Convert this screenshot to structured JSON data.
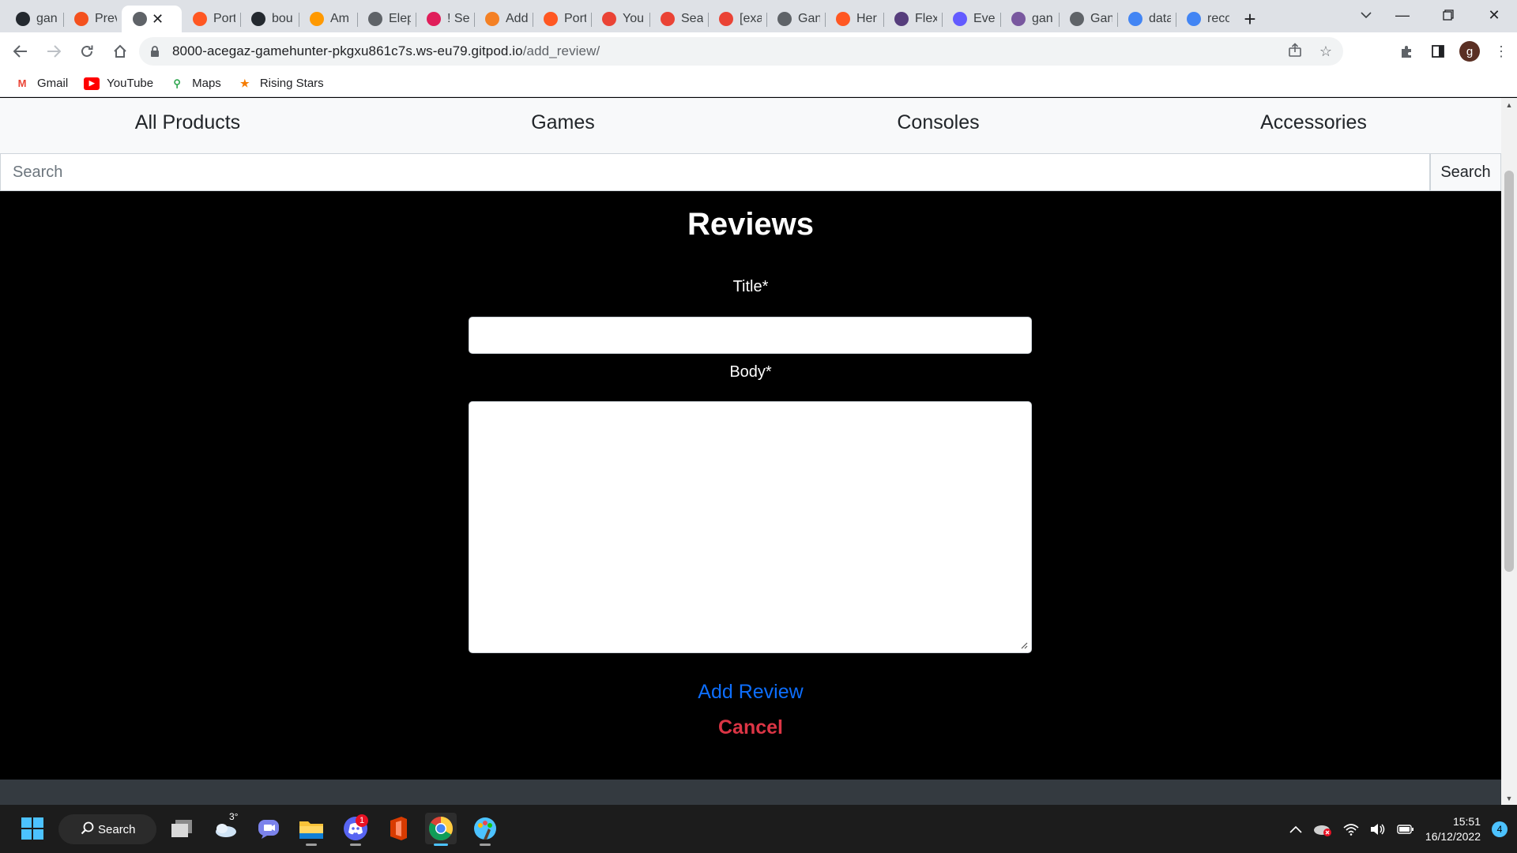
{
  "browser": {
    "tabs": [
      {
        "label": "gan",
        "icon": "github-icon",
        "color": "#24292f"
      },
      {
        "label": "Prev",
        "icon": "preview-icon",
        "color": "#f4511e"
      },
      {
        "label": "",
        "icon": "globe-icon",
        "color": "#5f6368",
        "active": true
      },
      {
        "label": "Port",
        "icon": "portfolio-icon",
        "color": "#ff5722"
      },
      {
        "label": "bou",
        "icon": "github-icon",
        "color": "#24292f"
      },
      {
        "label": "Am",
        "icon": "aws-icon",
        "color": "#ff9900"
      },
      {
        "label": "Elep",
        "icon": "elephant-icon",
        "color": "#5f6368"
      },
      {
        "label": "! Se",
        "icon": "slack-icon",
        "color": "#e01e5a"
      },
      {
        "label": "Add",
        "icon": "stackoverflow-icon",
        "color": "#f48024"
      },
      {
        "label": "Port",
        "icon": "portfolio-icon",
        "color": "#ff5722"
      },
      {
        "label": "You",
        "icon": "gmail-icon",
        "color": "#ea4335"
      },
      {
        "label": "Sea",
        "icon": "gmail-icon",
        "color": "#ea4335"
      },
      {
        "label": "[exa",
        "icon": "gmail-icon",
        "color": "#ea4335"
      },
      {
        "label": "Gan",
        "icon": "globe-icon",
        "color": "#5f6368"
      },
      {
        "label": "Her",
        "icon": "portfolio-icon",
        "color": "#ff5722"
      },
      {
        "label": "Flex",
        "icon": "bootstrap-icon",
        "color": "#563d7c"
      },
      {
        "label": "Ever",
        "icon": "stripe-icon",
        "color": "#635bff"
      },
      {
        "label": "gan",
        "icon": "heroku-icon",
        "color": "#79589f"
      },
      {
        "label": "Gan",
        "icon": "globe-icon",
        "color": "#5f6368"
      },
      {
        "label": "data",
        "icon": "google-icon",
        "color": "#4285f4"
      },
      {
        "label": "reco",
        "icon": "google-icon",
        "color": "#4285f4"
      }
    ],
    "url_host": "8000-acegaz-gamehunter-pkgxu861c7s.ws-eu79.gitpod.io",
    "url_path": "/add_review/",
    "profile_initial": "g",
    "bookmarks": [
      {
        "label": "Gmail",
        "icon": "gmail-icon",
        "color": "#ea4335"
      },
      {
        "label": "YouTube",
        "icon": "youtube-icon",
        "color": "#ff0000"
      },
      {
        "label": "Maps",
        "icon": "maps-icon",
        "color": "#34a853"
      },
      {
        "label": "Rising Stars",
        "icon": "star-icon",
        "color": "#f57c00"
      }
    ]
  },
  "page": {
    "nav": [
      "All Products",
      "Games",
      "Consoles",
      "Accessories"
    ],
    "search_placeholder": "Search",
    "search_button": "Search",
    "title": "Reviews",
    "form": {
      "title_label": "Title*",
      "title_value": "",
      "body_label": "Body*",
      "body_value": "",
      "submit_label": "Add Review",
      "cancel_label": "Cancel"
    },
    "colors": {
      "submit": "#0d6efd",
      "cancel": "#dc3545",
      "background": "#000000",
      "footer": "#343a40"
    }
  },
  "taskbar": {
    "search_label": "Search",
    "weather_temp": "3°",
    "discord_badge": "1",
    "time": "15:51",
    "date": "16/12/2022",
    "notifications": "4"
  }
}
